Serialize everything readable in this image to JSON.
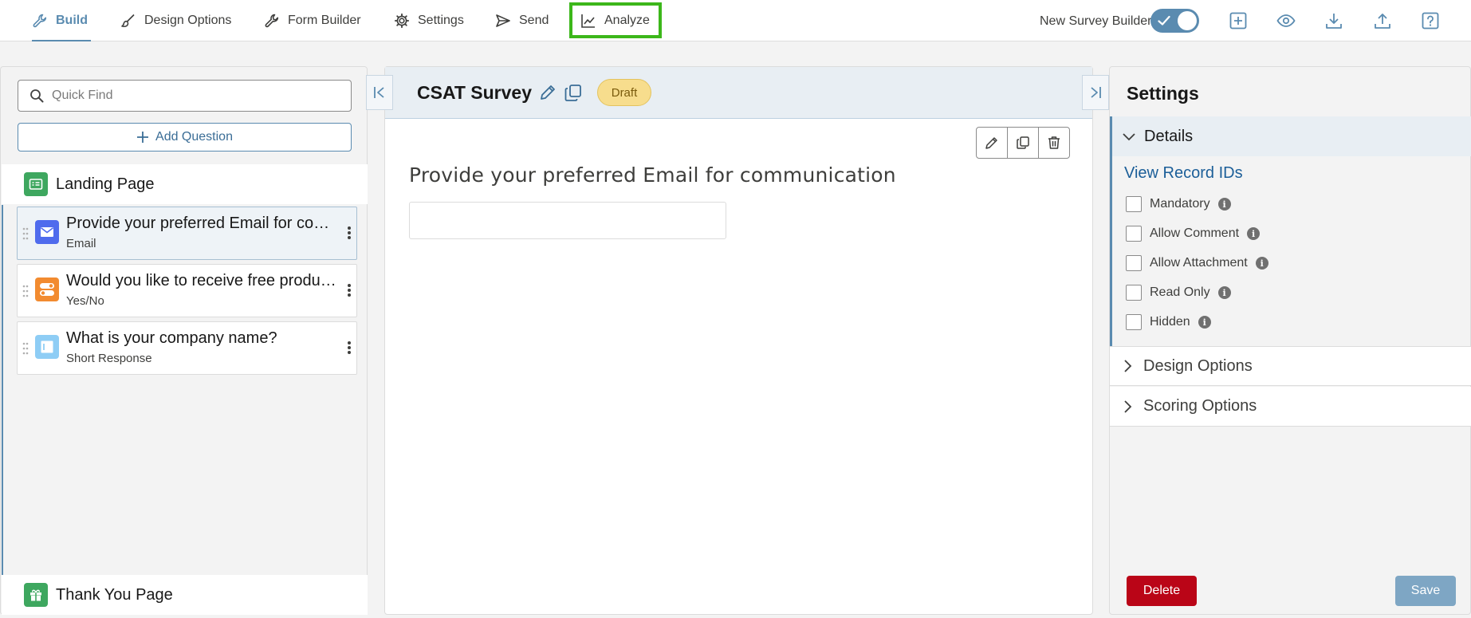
{
  "nav": {
    "tabs": [
      {
        "label": "Build",
        "icon": "wrench-icon"
      },
      {
        "label": "Design Options",
        "icon": "paintbrush-icon"
      },
      {
        "label": "Form Builder",
        "icon": "wrench-icon"
      },
      {
        "label": "Settings",
        "icon": "gear-icon"
      },
      {
        "label": "Send",
        "icon": "send-icon"
      },
      {
        "label": "Analyze",
        "icon": "line-chart-icon"
      }
    ],
    "active_tab": "Build",
    "highlighted_tab": "Analyze",
    "builder_toggle_label": "New Survey Builder",
    "builder_toggle_on": true,
    "toolbar_icons": [
      "add-icon",
      "preview-eye-icon",
      "download-icon",
      "upload-icon",
      "help-icon"
    ]
  },
  "left": {
    "search_placeholder": "Quick Find",
    "add_question_label": "Add Question",
    "landing_page_label": "Landing Page",
    "thank_you_label": "Thank You Page",
    "questions": [
      {
        "title": "Provide your preferred Email for communication",
        "type": "Email",
        "icon": "email-icon",
        "color": "#4f6bed",
        "selected": true
      },
      {
        "title": "Would you like to receive free product updates?",
        "type": "Yes/No",
        "icon": "toggle-icon",
        "color": "#f28b30",
        "selected": false
      },
      {
        "title": "What is your company name?",
        "type": "Short Response",
        "icon": "short-response-icon",
        "color": "#8ecdf5",
        "selected": false
      }
    ]
  },
  "center": {
    "survey_title": "CSAT Survey",
    "status": "Draft",
    "question_text": "Provide your preferred Email for communication",
    "answer_value": ""
  },
  "right": {
    "title": "Settings",
    "details_label": "Details",
    "record_ids_link": "View Record IDs",
    "options": [
      {
        "label": "Mandatory",
        "checked": false
      },
      {
        "label": "Allow Comment",
        "checked": false
      },
      {
        "label": "Allow Attachment",
        "checked": false
      },
      {
        "label": "Read Only",
        "checked": false
      },
      {
        "label": "Hidden",
        "checked": false
      }
    ],
    "sections": [
      "Design Options",
      "Scoring Options"
    ],
    "delete_label": "Delete",
    "save_label": "Save"
  },
  "colors": {
    "accent": "#5a8bb0",
    "highlight": "#3cb71a",
    "delete": "#ba0517",
    "draft_badge": "#f7dd8d"
  }
}
